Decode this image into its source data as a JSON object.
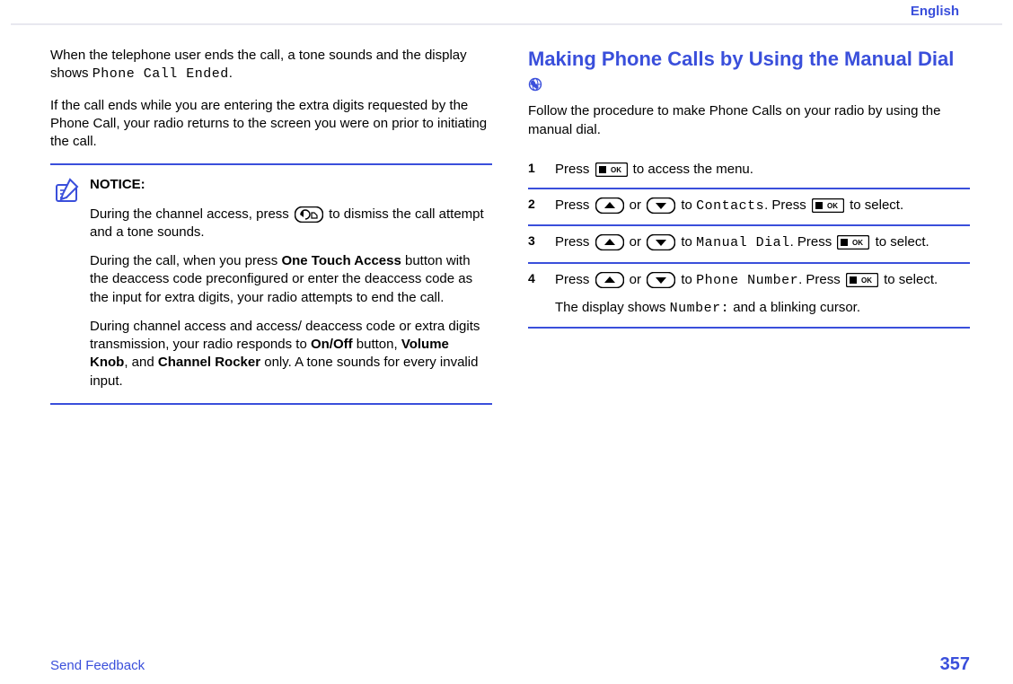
{
  "header": {
    "language": "English"
  },
  "left": {
    "p1a": "When the telephone user ends the call, a tone sounds and the display shows ",
    "p1b": "Phone Call Ended",
    "p1c": ".",
    "p2": "If the call ends while you are entering the extra digits requested by the Phone Call, your radio returns to the screen you were on prior to initiating the call.",
    "notice": {
      "title": "NOTICE:",
      "n1a": "During the channel access, press ",
      "n1b": " to dismiss the call attempt and a tone sounds.",
      "n2a": "During the call, when you press ",
      "n2b": "One Touch Access",
      "n2c": " button with the deaccess code preconfigured or enter the deaccess code as the input for extra digits, your radio attempts to end the call.",
      "n3a": "During channel access and access/ deaccess code or extra digits transmission, your radio responds to ",
      "n3b": "On/Off",
      "n3c": " button, ",
      "n3d": "Volume Knob",
      "n3e": ", and ",
      "n3f": "Channel Rocker",
      "n3g": " only. A tone sounds for every invalid input."
    }
  },
  "right": {
    "heading": "Making Phone Calls by Using the Manual Dial ",
    "sub": "Follow the procedure to make Phone Calls on your radio by using the manual dial.",
    "steps": {
      "s1": {
        "num": "1",
        "a": "Press ",
        "b": " to access the menu."
      },
      "s2": {
        "num": "2",
        "a": "Press ",
        "b": " or ",
        "c": " to ",
        "d": "Contacts",
        "e": ". Press ",
        "f": " to select."
      },
      "s3": {
        "num": "3",
        "a": "Press ",
        "b": " or ",
        "c": " to ",
        "d": "Manual Dial",
        "e": ". Press ",
        "f": " to select."
      },
      "s4": {
        "num": "4",
        "a": "Press ",
        "b": " or ",
        "c": " to ",
        "d": "Phone Number",
        "e": ". Press ",
        "f": " to select.",
        "g1": "The display shows ",
        "g2": "Number:",
        "g3": " and a blinking cursor."
      }
    }
  },
  "footer": {
    "feedback": "Send Feedback",
    "page": "357"
  }
}
